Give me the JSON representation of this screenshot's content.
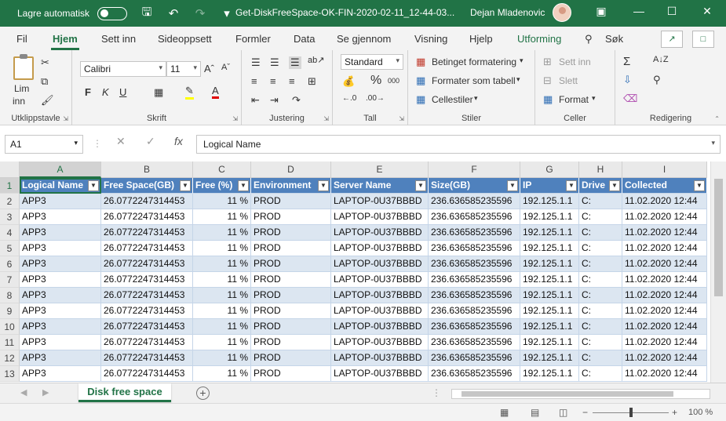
{
  "titlebar": {
    "autosave_label": "Lagre automatisk",
    "document_title": "Get-DiskFreeSpace-OK-FIN-2020-02-11_12-44-03...",
    "user_name": "Dejan Mladenovic"
  },
  "ribbon_tabs": [
    "Fil",
    "Hjem",
    "Sett inn",
    "Sideoppsett",
    "Formler",
    "Data",
    "Se gjennom",
    "Visning",
    "Hjelp",
    "Utforming",
    "Søk"
  ],
  "ribbon": {
    "clipboard": {
      "paste": "Lim",
      "paste2": "inn",
      "label": "Utklippstavle"
    },
    "font": {
      "family": "Calibri",
      "size": "11",
      "bold": "F",
      "italic": "K",
      "underline": "U",
      "label": "Skrift"
    },
    "alignment": {
      "label": "Justering"
    },
    "number": {
      "format": "Standard",
      "percent": "%",
      "thousands": "000",
      "label": "Tall"
    },
    "styles": {
      "conditional": "Betinget formatering",
      "table": "Formater som tabell",
      "cell": "Cellestiler",
      "label": "Stiler"
    },
    "cells": {
      "insert": "Sett inn",
      "delete": "Slett",
      "format": "Format",
      "label": "Celler"
    },
    "editing": {
      "label": "Redigering"
    }
  },
  "formula_bar": {
    "name_box": "A1",
    "fx": "fx",
    "content": "Logical Name"
  },
  "columns": [
    "A",
    "B",
    "C",
    "D",
    "E",
    "F",
    "G",
    "H",
    "I"
  ],
  "table": {
    "headers": [
      "Logical Name",
      "Free Space(GB)",
      "Free (%)",
      "Environment",
      "Server Name",
      "Size(GB)",
      "IP",
      "Drive",
      "Collected"
    ],
    "rows": [
      [
        "APP3",
        "26.0772247314453",
        "11 %",
        "PROD",
        "LAPTOP-0U37BBBD",
        "236.636585235596",
        "192.125.1.1",
        "C:",
        "11.02.2020 12:44"
      ],
      [
        "APP3",
        "26.0772247314453",
        "11 %",
        "PROD",
        "LAPTOP-0U37BBBD",
        "236.636585235596",
        "192.125.1.1",
        "C:",
        "11.02.2020 12:44"
      ],
      [
        "APP3",
        "26.0772247314453",
        "11 %",
        "PROD",
        "LAPTOP-0U37BBBD",
        "236.636585235596",
        "192.125.1.1",
        "C:",
        "11.02.2020 12:44"
      ],
      [
        "APP3",
        "26.0772247314453",
        "11 %",
        "PROD",
        "LAPTOP-0U37BBBD",
        "236.636585235596",
        "192.125.1.1",
        "C:",
        "11.02.2020 12:44"
      ],
      [
        "APP3",
        "26.0772247314453",
        "11 %",
        "PROD",
        "LAPTOP-0U37BBBD",
        "236.636585235596",
        "192.125.1.1",
        "C:",
        "11.02.2020 12:44"
      ],
      [
        "APP3",
        "26.0772247314453",
        "11 %",
        "PROD",
        "LAPTOP-0U37BBBD",
        "236.636585235596",
        "192.125.1.1",
        "C:",
        "11.02.2020 12:44"
      ],
      [
        "APP3",
        "26.0772247314453",
        "11 %",
        "PROD",
        "LAPTOP-0U37BBBD",
        "236.636585235596",
        "192.125.1.1",
        "C:",
        "11.02.2020 12:44"
      ],
      [
        "APP3",
        "26.0772247314453",
        "11 %",
        "PROD",
        "LAPTOP-0U37BBBD",
        "236.636585235596",
        "192.125.1.1",
        "C:",
        "11.02.2020 12:44"
      ],
      [
        "APP3",
        "26.0772247314453",
        "11 %",
        "PROD",
        "LAPTOP-0U37BBBD",
        "236.636585235596",
        "192.125.1.1",
        "C:",
        "11.02.2020 12:44"
      ],
      [
        "APP3",
        "26.0772247314453",
        "11 %",
        "PROD",
        "LAPTOP-0U37BBBD",
        "236.636585235596",
        "192.125.1.1",
        "C:",
        "11.02.2020 12:44"
      ],
      [
        "APP3",
        "26.0772247314453",
        "11 %",
        "PROD",
        "LAPTOP-0U37BBBD",
        "236.636585235596",
        "192.125.1.1",
        "C:",
        "11.02.2020 12:44"
      ],
      [
        "APP3",
        "26.0772247314453",
        "11 %",
        "PROD",
        "LAPTOP-0U37BBBD",
        "236.636585235596",
        "192.125.1.1",
        "C:",
        "11.02.2020 12:44"
      ]
    ]
  },
  "row_numbers": [
    "1",
    "2",
    "3",
    "4",
    "5",
    "6",
    "7",
    "8",
    "9",
    "10",
    "11",
    "12",
    "13"
  ],
  "sheet_tabs": {
    "active": "Disk free space"
  },
  "status": {
    "zoom": "100 %"
  },
  "colors": {
    "accent": "#217346",
    "table_header": "#4f81bd",
    "table_band": "#dce6f1"
  }
}
